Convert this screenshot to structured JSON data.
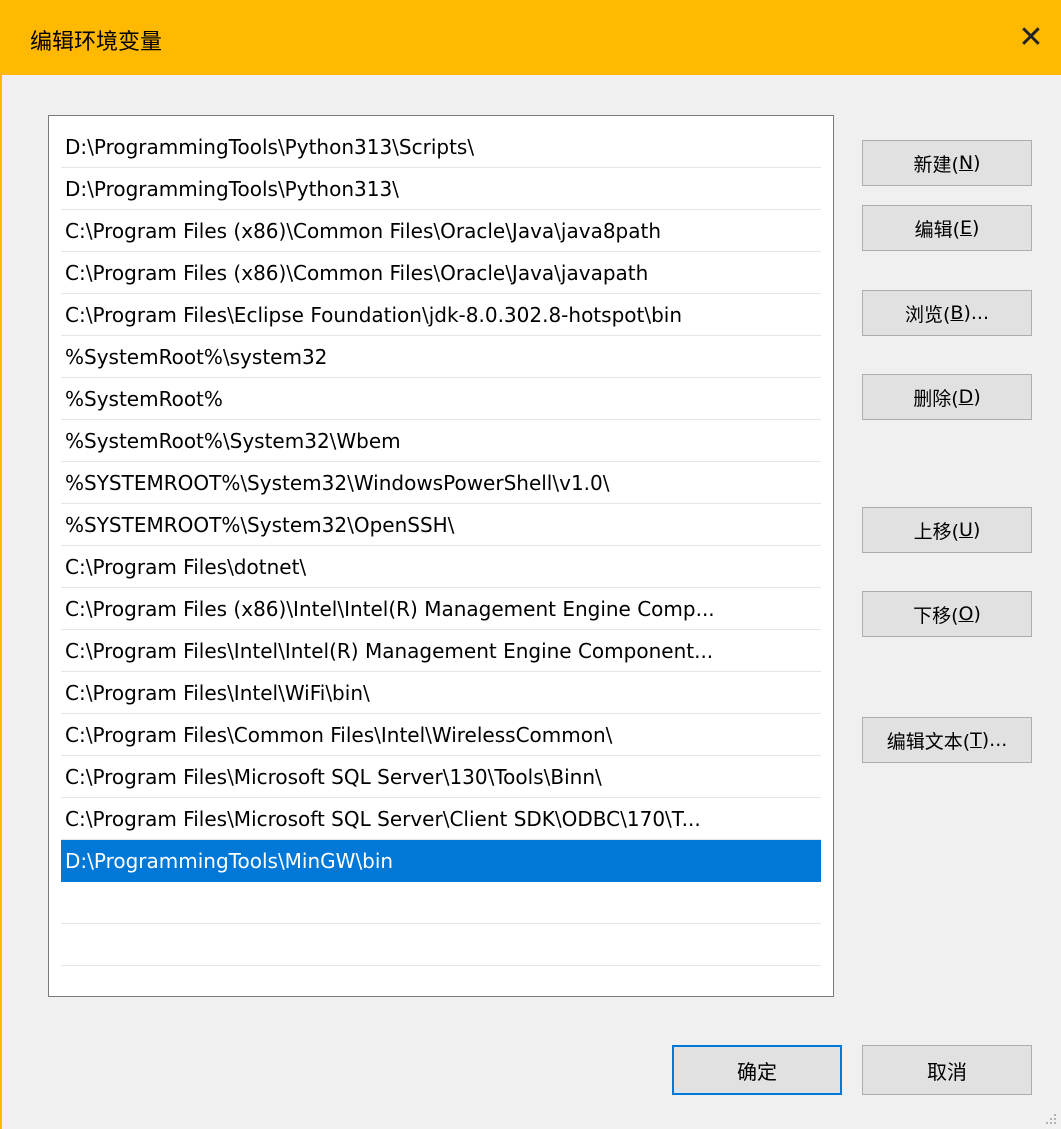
{
  "window": {
    "title": "编辑环境变量",
    "close_glyph": "✕"
  },
  "paths": [
    "D:\\ProgrammingTools\\Python313\\Scripts\\",
    "D:\\ProgrammingTools\\Python313\\",
    "C:\\Program Files (x86)\\Common Files\\Oracle\\Java\\java8path",
    "C:\\Program Files (x86)\\Common Files\\Oracle\\Java\\javapath",
    "C:\\Program Files\\Eclipse Foundation\\jdk-8.0.302.8-hotspot\\bin",
    "%SystemRoot%\\system32",
    "%SystemRoot%",
    "%SystemRoot%\\System32\\Wbem",
    "%SYSTEMROOT%\\System32\\WindowsPowerShell\\v1.0\\",
    "%SYSTEMROOT%\\System32\\OpenSSH\\",
    "C:\\Program Files\\dotnet\\",
    "C:\\Program Files (x86)\\Intel\\Intel(R) Management Engine Comp...",
    "C:\\Program Files\\Intel\\Intel(R) Management Engine Component...",
    "C:\\Program Files\\Intel\\WiFi\\bin\\",
    "C:\\Program Files\\Common Files\\Intel\\WirelessCommon\\",
    "C:\\Program Files\\Microsoft SQL Server\\130\\Tools\\Binn\\",
    "C:\\Program Files\\Microsoft SQL Server\\Client SDK\\ODBC\\170\\T...",
    "D:\\ProgrammingTools\\MinGW\\bin",
    "",
    "",
    ""
  ],
  "selected_index": 17,
  "buttons": {
    "new": {
      "text": "新建(",
      "key": "N",
      "end": ")"
    },
    "edit": {
      "text": "编辑(",
      "key": "E",
      "end": ")"
    },
    "browse": {
      "text": "浏览(",
      "key": "B",
      "end": ")..."
    },
    "delete": {
      "text": "删除(",
      "key": "D",
      "end": ")"
    },
    "move_up": {
      "text": "上移(",
      "key": "U",
      "end": ")"
    },
    "move_down": {
      "text": "下移(",
      "key": "O",
      "end": ")"
    },
    "edit_text": {
      "text": "编辑文本(",
      "key": "T",
      "end": ")..."
    }
  },
  "footer": {
    "ok_label": "确定",
    "cancel_label": "取消"
  },
  "colors": {
    "titlebar": "#ffb900",
    "selection": "#0078d7"
  }
}
